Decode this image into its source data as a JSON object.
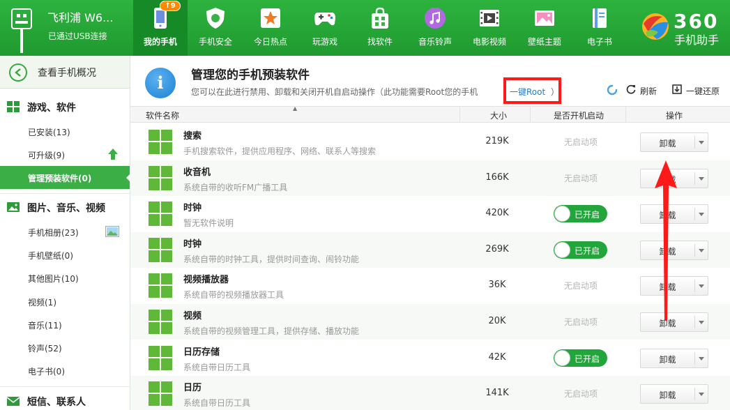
{
  "device": {
    "name": "飞利浦 W6...",
    "status": "已通过USB连接"
  },
  "nav": {
    "badge": "9",
    "tabs": [
      {
        "label": "我的手机",
        "icon": "phone-icon",
        "active": true
      },
      {
        "label": "手机安全",
        "icon": "shield-icon"
      },
      {
        "label": "今日热点",
        "icon": "star-icon"
      },
      {
        "label": "玩游戏",
        "icon": "gamepad-icon"
      },
      {
        "label": "找软件",
        "icon": "bag-icon"
      },
      {
        "label": "音乐铃声",
        "icon": "music-icon"
      },
      {
        "label": "电影视频",
        "icon": "film-icon"
      },
      {
        "label": "壁纸主题",
        "icon": "picture-icon"
      },
      {
        "label": "电子书",
        "icon": "book-icon"
      }
    ]
  },
  "brand": {
    "number": "360",
    "subtitle": "手机助手"
  },
  "sidebar": {
    "overview": "查看手机概况",
    "sections": [
      {
        "label": "游戏、软件",
        "icon": "apps-grid-icon",
        "items": [
          "已安装(13)",
          "可升级(9)",
          "管理预装软件(0)"
        ]
      },
      {
        "label": "图片、音乐、视频",
        "icon": "image-icon",
        "items": [
          "手机相册(23)",
          "手机壁纸(0)",
          "其他图片(10)",
          "视频(1)",
          "音乐(11)",
          "铃声(52)",
          "电子书(0)"
        ]
      },
      {
        "label": "短信、联系人",
        "icon": "mail-icon",
        "items": []
      }
    ],
    "active_item": "管理预装软件(0)"
  },
  "main": {
    "title": "管理您的手机预装软件",
    "description": "您可以在此进行禁用、卸载和关闭开机自启动操作（此功能需要Root您的手机",
    "root_link": "一键Root",
    "desc_close": "）",
    "toolbar": {
      "refresh": "刷新",
      "restore": "一键还原"
    },
    "columns": {
      "name": "软件名称",
      "size": "大小",
      "autostart": "是否开机启动",
      "action": "操作"
    },
    "apps": [
      {
        "name": "搜索",
        "desc": "手机搜索软件，提供应用程序、网络、联系人等搜索",
        "size": "219K",
        "autostart": "无启动项",
        "enabled": false
      },
      {
        "name": "收音机",
        "desc": "系统自带的收听FM广播工具",
        "size": "166K",
        "autostart": "无启动项",
        "enabled": false
      },
      {
        "name": "时钟",
        "desc": "暂无软件说明",
        "size": "420K",
        "autostart": "已开启",
        "enabled": true
      },
      {
        "name": "时钟",
        "desc": "系统自带的时钟工具，提供时间查询、闹铃功能",
        "size": "269K",
        "autostart": "已开启",
        "enabled": true
      },
      {
        "name": "视频播放器",
        "desc": "系统自带的视频播放器工具",
        "size": "36K",
        "autostart": "无启动项",
        "enabled": false
      },
      {
        "name": "视频",
        "desc": "系统自带的视频管理工具，提供存储、播放功能",
        "size": "20K",
        "autostart": "无启动项",
        "enabled": false
      },
      {
        "name": "日历存储",
        "desc": "系统自带日历工具",
        "size": "42K",
        "autostart": "已开启",
        "enabled": true
      },
      {
        "name": "日历",
        "desc": "系统自带日历工具",
        "size": "141K",
        "autostart": "无启动项",
        "enabled": false
      }
    ],
    "uninstall_label": "卸载"
  },
  "colors": {
    "brand_green": "#2eb33f",
    "active_green": "#3bae46",
    "link_blue": "#1c7fd3",
    "highlight_red": "#ff1a1a"
  }
}
